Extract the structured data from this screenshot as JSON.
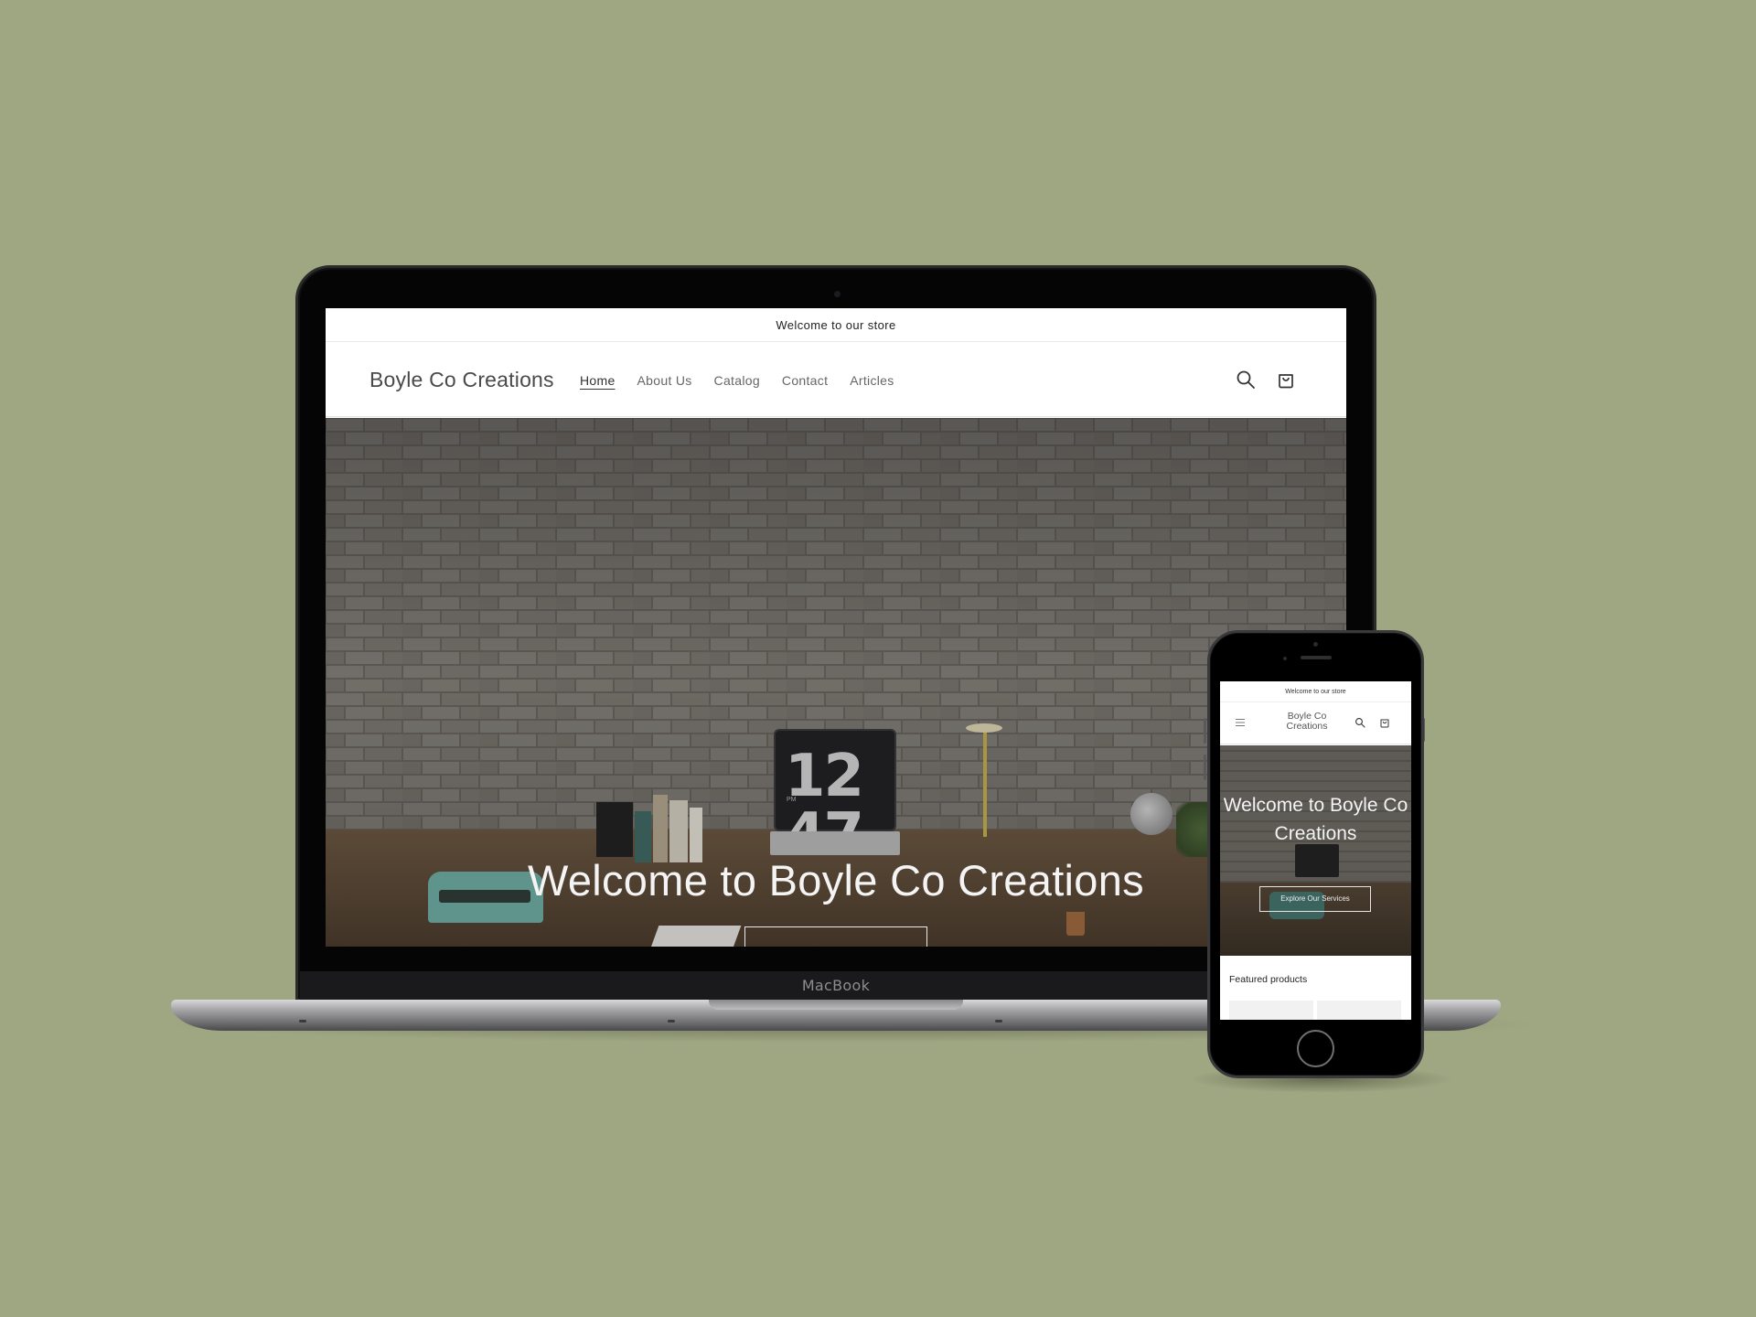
{
  "laptop": {
    "device_label": "MacBook",
    "announcement": "Welcome to our store",
    "brand": "Boyle Co Creations",
    "nav": [
      "Home",
      "About Us",
      "Catalog",
      "Contact",
      "Articles"
    ],
    "active_nav": "Home",
    "hero": {
      "title": "Welcome to Boyle Co Creations",
      "clock_hour": "12",
      "clock_minute": "47",
      "clock_period": "PM"
    },
    "icons": [
      "search-icon",
      "cart-icon"
    ]
  },
  "phone": {
    "announcement": "Welcome to our store",
    "brand": "Boyle Co Creations",
    "hero": {
      "title": "Welcome to Boyle Co Creations",
      "button": "Explore Our Services"
    },
    "featured_heading": "Featured products",
    "icons": [
      "menu-icon",
      "search-icon",
      "cart-icon"
    ]
  },
  "colors": {
    "background": "#9fa682",
    "device_body": "#050505",
    "hero_text": "#f4f4f4",
    "nav_text": "#666666"
  }
}
